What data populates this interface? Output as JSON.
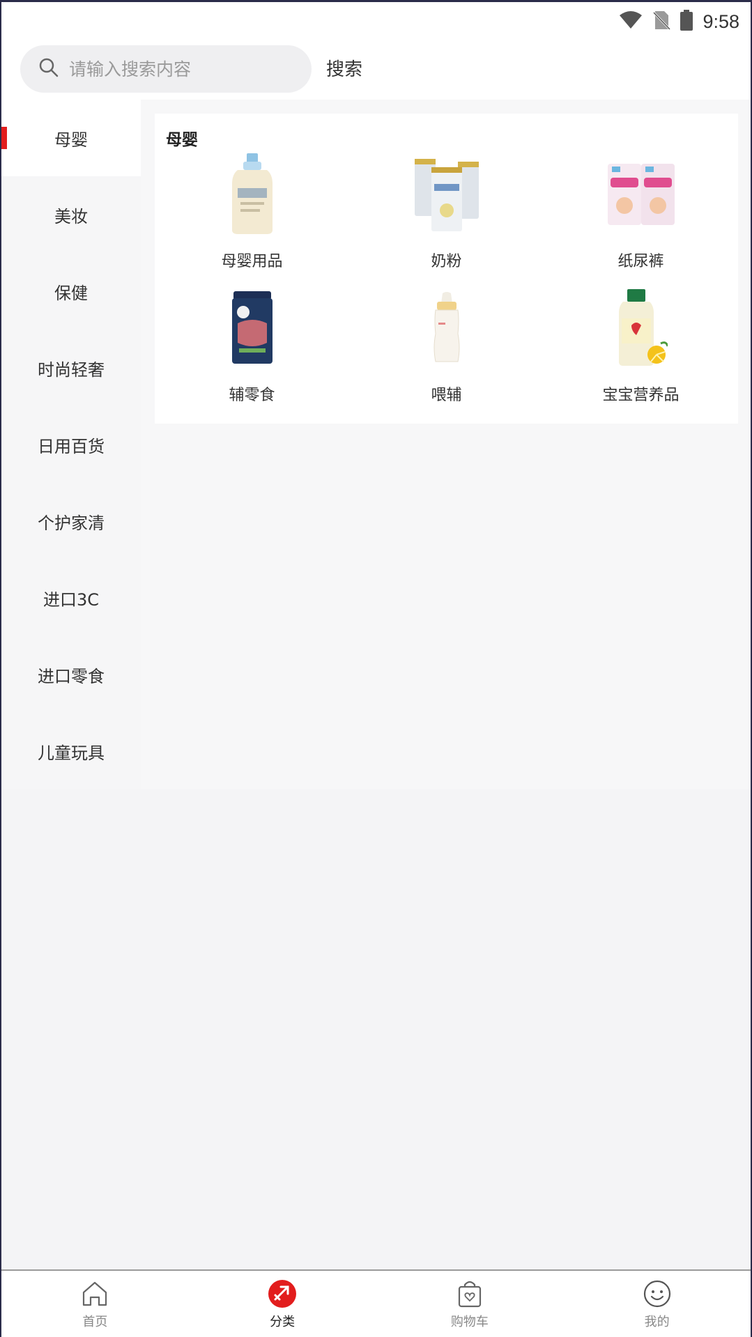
{
  "status_bar": {
    "time": "9:58"
  },
  "search": {
    "placeholder": "请输入搜索内容",
    "button_label": "搜索"
  },
  "sidebar": {
    "items": [
      {
        "label": "母婴",
        "active": true
      },
      {
        "label": "美妆"
      },
      {
        "label": "保健"
      },
      {
        "label": "时尚轻奢"
      },
      {
        "label": "日用百货"
      },
      {
        "label": "个护家清"
      },
      {
        "label": "进口3C"
      },
      {
        "label": "进口零食"
      },
      {
        "label": "儿童玩具"
      }
    ]
  },
  "main": {
    "section_title": "母婴",
    "items": [
      {
        "label": "母婴用品",
        "icon": "lotion-bottle-icon"
      },
      {
        "label": "奶粉",
        "icon": "milk-powder-cans-icon"
      },
      {
        "label": "纸尿裤",
        "icon": "diaper-pack-icon"
      },
      {
        "label": "辅零食",
        "icon": "baby-cereal-can-icon"
      },
      {
        "label": "喂辅",
        "icon": "baby-bottle-icon"
      },
      {
        "label": "宝宝营养品",
        "icon": "supplement-bottle-icon"
      }
    ]
  },
  "bottom_nav": {
    "items": [
      {
        "label": "首页",
        "icon": "home-icon"
      },
      {
        "label": "分类",
        "icon": "category-icon",
        "active": true
      },
      {
        "label": "购物车",
        "icon": "shopping-bag-icon"
      },
      {
        "label": "我的",
        "icon": "smiley-profile-icon"
      }
    ]
  },
  "colors": {
    "accent": "#e21d1d",
    "frame": "#2b2c4a"
  }
}
